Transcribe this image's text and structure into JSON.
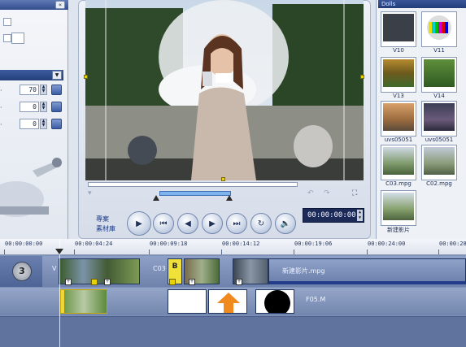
{
  "left_panel": {
    "collapse_glyph": "«",
    "numeric_fields": [
      {
        "value": "70"
      },
      {
        "value": "0"
      },
      {
        "value": "0"
      }
    ]
  },
  "preview": {
    "mode_labels": [
      "專案",
      "素材庫"
    ],
    "timecode": "00:00:00:00",
    "controls": [
      "play",
      "home",
      "previous-frame",
      "next-frame",
      "end",
      "repeat",
      "volume"
    ]
  },
  "library": {
    "header": "Dolls",
    "thumbnails": [
      {
        "label": "V10",
        "icon": "blank-frame"
      },
      {
        "label": "V11",
        "icon": "color-bars"
      },
      {
        "label": "V13",
        "icon": "nature-clip"
      },
      {
        "label": "V14",
        "icon": "nature-clip"
      },
      {
        "label": "uvs05051",
        "icon": "children-clip"
      },
      {
        "label": "uvs05051",
        "icon": "children-clip"
      },
      {
        "label": "C03.mpg",
        "icon": "outdoor-clip"
      },
      {
        "label": "C02.mpg",
        "icon": "outdoor-clip"
      },
      {
        "label": "新建影片",
        "icon": "outdoor-clip"
      }
    ]
  },
  "timeline": {
    "ruler": [
      "00:00:00:00",
      "00:00:04:24",
      "00:00:09:18",
      "00:00:14:12",
      "00:00:19:06",
      "00:00:24:00",
      "00:00:28"
    ],
    "video_track": {
      "title_marker": "V",
      "transition_marker": "B",
      "clip_labels": [
        "C03",
        "新建影片.mpg"
      ]
    },
    "overlay_track": {
      "clip_label": "F05.M"
    }
  },
  "colors": {
    "accent": "#23407c",
    "timecode_bg": "#1c2a58",
    "timeline_bg": "#7b8fb8",
    "marker_yellow": "#e8d200"
  }
}
